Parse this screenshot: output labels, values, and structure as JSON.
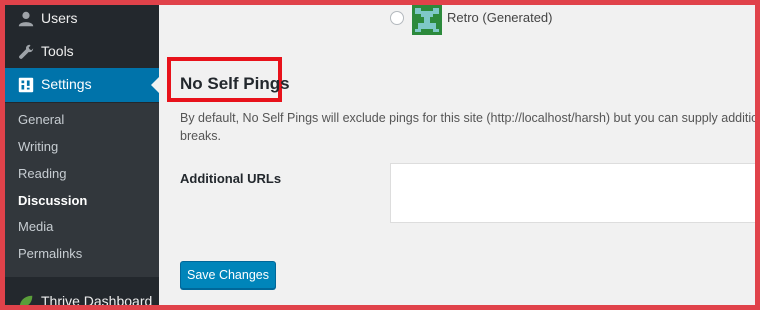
{
  "sidebar": {
    "top_items": [
      {
        "label": "Users",
        "icon": "user-icon"
      },
      {
        "label": "Tools",
        "icon": "wrench-icon"
      },
      {
        "label": "Settings",
        "icon": "settings-icon",
        "active": true
      }
    ],
    "submenu": [
      {
        "label": "General"
      },
      {
        "label": "Writing"
      },
      {
        "label": "Reading"
      },
      {
        "label": "Discussion",
        "current": true
      },
      {
        "label": "Media"
      },
      {
        "label": "Permalinks"
      }
    ],
    "extra_item": {
      "label": "Thrive Dashboard",
      "icon": "thrive-leaf-icon"
    }
  },
  "avatar_option": {
    "label": "Retro (Generated)",
    "selected": false
  },
  "section": {
    "title": "No Self Pings",
    "description": "By default, No Self Pings will exclude pings for this site (http://localhost/harsh) but you can supply additio breaks."
  },
  "field": {
    "label": "Additional URLs",
    "value": ""
  },
  "save_button": {
    "label": "Save Changes"
  },
  "colors": {
    "sidebar_bg": "#23282d",
    "submenu_bg": "#32373c",
    "active_menu": "#0073aa",
    "button_primary": "#0085ba",
    "highlight_border": "#e8121b",
    "outer_border": "#e0424a"
  }
}
